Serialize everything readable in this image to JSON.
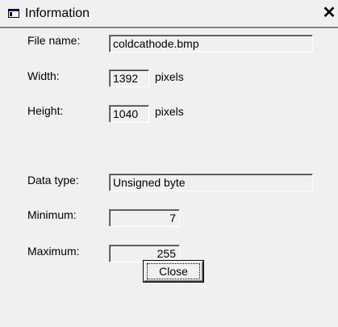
{
  "window": {
    "title": "Information",
    "icon": "info-window-icon",
    "close_glyph": "✕"
  },
  "fields": {
    "file_name": {
      "label": "File name:",
      "value": "coldcathode.bmp"
    },
    "width": {
      "label": "Width:",
      "value": "1392",
      "unit": "pixels"
    },
    "height": {
      "label": "Height:",
      "value": "1040",
      "unit": "pixels"
    },
    "data_type": {
      "label": "Data type:",
      "value": "Unsigned byte"
    },
    "minimum": {
      "label": "Minimum:",
      "value": "7"
    },
    "maximum": {
      "label": "Maximum:",
      "value": "255"
    }
  },
  "buttons": {
    "close_label": "Close"
  }
}
